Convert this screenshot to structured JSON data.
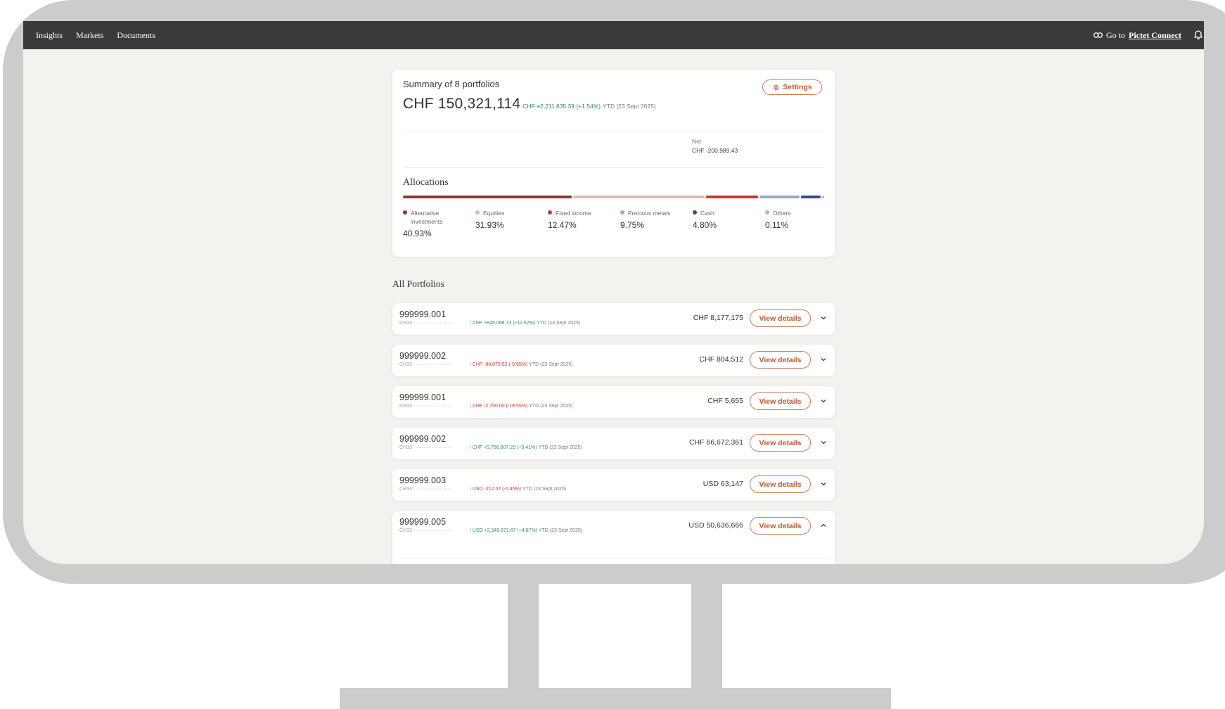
{
  "nav": {
    "links": [
      "Insights",
      "Markets",
      "Documents"
    ],
    "goto_prefix": "Go to",
    "goto_target": "Pictet Connect"
  },
  "summary": {
    "title": "Summary of 8 portfolios",
    "total": "CHF 150,321,114",
    "change": "CHF +2,211,835.39 (+1.54%)",
    "ytd": "YTD (23 Sept 2025)",
    "settings_label": "Settings",
    "net_label": "Net",
    "net_value": "CHF -200,989.43"
  },
  "allocations": {
    "title": "Allocations",
    "items": [
      {
        "name": "Alternative investments",
        "pct": "40.93%",
        "value": 40.93,
        "color": "#8b3a2b"
      },
      {
        "name": "Equities",
        "pct": "31.93%",
        "value": 31.93,
        "color": "#e3b9ad"
      },
      {
        "name": "Fixed income",
        "pct": "12.47%",
        "value": 12.47,
        "color": "#c0392b"
      },
      {
        "name": "Precious metals",
        "pct": "9.75%",
        "value": 9.75,
        "color": "#9aa9c0"
      },
      {
        "name": "Cash",
        "pct": "4.80%",
        "value": 4.8,
        "color": "#2f4d8c"
      },
      {
        "name": "Others",
        "pct": "0.11%",
        "value": 0.11,
        "color": "#e0a98a"
      }
    ]
  },
  "portfolios_title": "All Portfolios",
  "portfolios": [
    {
      "id": "999999.001",
      "iban": "CH33 ························",
      "change": "CHF +845,088.73 (+11.52%)",
      "trend": "pos",
      "ytd": "YTD (23 Sept 2025)",
      "amount": "CHF 8,177,175",
      "button": "View details",
      "expanded": false
    },
    {
      "id": "999999.002",
      "iban": "CH33 ························",
      "change": "CHF -84,075.52 (-9.55%)",
      "trend": "neg",
      "ytd": "YTD (23 Sept 2025)",
      "amount": "CHF 804,512",
      "button": "View details",
      "expanded": false
    },
    {
      "id": "999999.001",
      "iban": "CH33 ························",
      "change": "CHF -2,700.00 (-18.55%)",
      "trend": "neg",
      "ytd": "YTD (23 Sept 2025)",
      "amount": "CHF 5,655",
      "button": "View details",
      "expanded": false
    },
    {
      "id": "999999.002",
      "iban": "CH33 ························",
      "change": "CHF +5,750,607.29 (+9.41%)",
      "trend": "pos",
      "ytd": "YTD (23 Sept 2025)",
      "amount": "CHF 66,672,361",
      "button": "View details",
      "expanded": false
    },
    {
      "id": "999999.003",
      "iban": "CH33 ························",
      "change": "USD -212.07 (-0.46%)",
      "trend": "neg",
      "ytd": "YTD (23 Sept 2025)",
      "amount": "USD 63,147",
      "button": "View details",
      "expanded": false
    },
    {
      "id": "999999.005",
      "iban": "CH33 ························",
      "change": "USD +2,349,871.67 (+4.87%)",
      "trend": "pos",
      "ytd": "YTD (23 Sept 2025)",
      "amount": "USD 50,636,666",
      "button": "View details",
      "expanded": true
    }
  ]
}
